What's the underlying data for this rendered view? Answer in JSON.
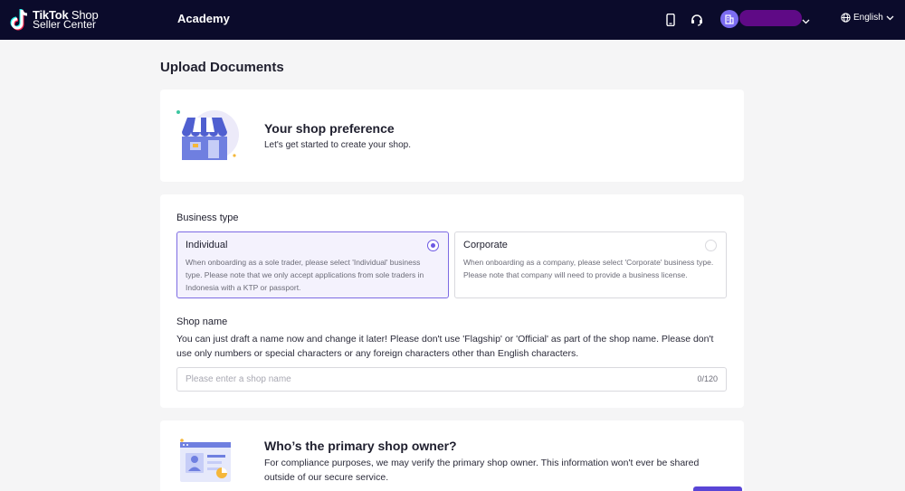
{
  "header": {
    "brand_line1_bold": "TikTok",
    "brand_line1_light": " Shop",
    "brand_line2": "Seller Center",
    "academy_label": "Academy",
    "language_label": "English"
  },
  "page": {
    "title": "Upload Documents"
  },
  "preference": {
    "heading": "Your shop preference",
    "subtitle": "Let's get started to create your shop."
  },
  "business_type": {
    "label": "Business type",
    "options": [
      {
        "title": "Individual",
        "description": "When onboarding as a sole trader, please select 'Individual' business type. Please note that we only accept applications from sole traders in Indonesia with a KTP or passport.",
        "selected": true
      },
      {
        "title": "Corporate",
        "description": "When onboarding as a company, please select 'Corporate' business type. Please note that company will need to provide a business license.",
        "selected": false
      }
    ]
  },
  "shop_name": {
    "label": "Shop name",
    "hint": "You can just draft a name now and change it later! Please don't use 'Flagship' or 'Official' as part of the shop name. Please don't use only numbers or special characters or any foreign characters other than English characters.",
    "placeholder": "Please enter a shop name",
    "value": "",
    "counter": "0/120"
  },
  "owner": {
    "heading": "Who’s the primary shop owner?",
    "subtitle": "For compliance purposes, we may verify the primary shop owner. This information won't ever be shared outside of our secure service."
  },
  "icons": {
    "brand": "tiktok-logo-icon",
    "phone": "mobile-phone-icon",
    "support": "headset-icon",
    "account": "shop-building-icon",
    "language": "globe-icon"
  },
  "colors": {
    "header_bg": "#0b0b2b",
    "accent": "#6d59e3",
    "selected_bg": "#f4f2fd",
    "page_bg": "#f5f5f6"
  }
}
